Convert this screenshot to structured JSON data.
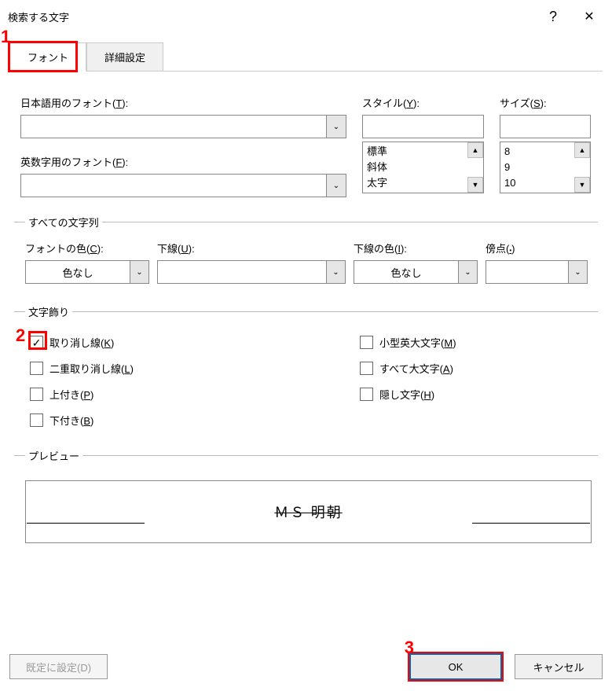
{
  "title": "検索する文字",
  "help_icon": "?",
  "close_icon": "✕",
  "annotations": {
    "a1": "1",
    "a2": "2",
    "a3": "3"
  },
  "tabs": {
    "font": "フォント",
    "advanced": "詳細設定"
  },
  "labels": {
    "jp_font_pre": "日本語用のフォント(",
    "jp_font_u": "T",
    "jp_font_post": "):",
    "latin_font_pre": "英数字用のフォント(",
    "latin_font_u": "F",
    "latin_font_post": "):",
    "style_pre": "スタイル(",
    "style_u": "Y",
    "style_post": "):",
    "size_pre": "サイズ(",
    "size_u": "S",
    "size_post": "):"
  },
  "style_list": [
    "標準",
    "斜体",
    "太字"
  ],
  "size_list": [
    "8",
    "9",
    "10"
  ],
  "all_text_section": "すべての文字列",
  "font_color_pre": "フォントの色(",
  "font_color_u": "C",
  "font_color_post": "):",
  "underline_pre": "下線(",
  "underline_u": "U",
  "underline_post": "):",
  "ul_color_pre": "下線の色(",
  "ul_color_u": "I",
  "ul_color_post": "):",
  "emphasis_pre": "傍点(",
  "emphasis_u": "•",
  "emphasis_post": ")",
  "color_none": "色なし",
  "deco_section": "文字飾り",
  "deco": {
    "strike_pre": "取り消し線(",
    "strike_u": "K",
    "strike_post": ")",
    "dstrike_pre": "二重取り消し線(",
    "dstrike_u": "L",
    "dstrike_post": ")",
    "sup_pre": "上付き(",
    "sup_u": "P",
    "sup_post": ")",
    "sub_pre": "下付き(",
    "sub_u": "B",
    "sub_post": ")",
    "smcap_pre": "小型英大文字(",
    "smcap_u": "M",
    "smcap_post": ")",
    "allcap_pre": "すべて大文字(",
    "allcap_u": "A",
    "allcap_post": ")",
    "hidden_pre": "隠し文字(",
    "hidden_u": "H",
    "hidden_post": ")"
  },
  "checkmark": "✓",
  "preview_section": "プレビュー",
  "preview_text": "ＭＳ 明朝",
  "chev_down": "⌄",
  "scroll_up": "▲",
  "scroll_down": "▼",
  "buttons": {
    "default": "既定に設定(D)",
    "ok": "OK",
    "cancel": "キャンセル"
  }
}
